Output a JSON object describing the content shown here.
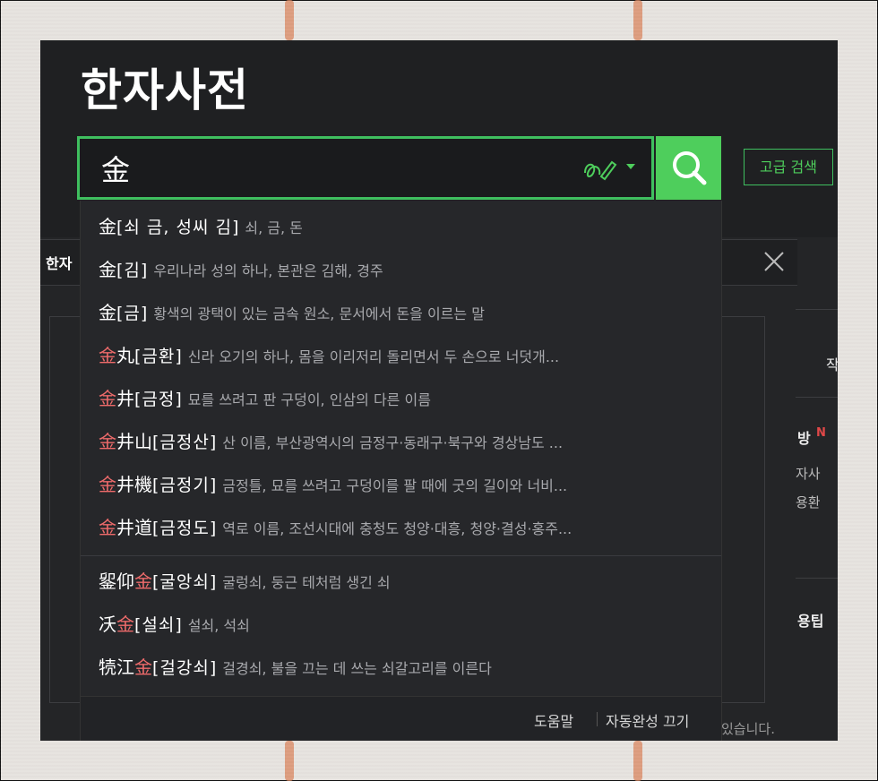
{
  "app": {
    "title": "한자사전",
    "search_value": "金",
    "advanced_search_label": "고급 검색"
  },
  "background_page": {
    "tab_label": "한자",
    "right_texts": [
      "작",
      "방",
      "N",
      "자사",
      "용환",
      "용팁",
      "있습니다."
    ]
  },
  "autocomplete": {
    "items": [
      {
        "hanja_pre": "金",
        "hanja_hl": "",
        "hanja_post": "",
        "reading": "[쇠 금, 성씨 김]",
        "definition": "쇠, 금, 돈"
      },
      {
        "hanja_pre": "金",
        "hanja_hl": "",
        "hanja_post": "",
        "reading": "[김]",
        "definition": "우리나라 성의 하나, 본관은 김해, 경주"
      },
      {
        "hanja_pre": "金",
        "hanja_hl": "",
        "hanja_post": "",
        "reading": "[금]",
        "definition": "황색의 광택이 있는 금속 원소, 문서에서 돈을 이르는 말"
      },
      {
        "hanja_pre": "",
        "hanja_hl": "金",
        "hanja_post": "丸",
        "reading": "[금환]",
        "definition": "신라 오기의 하나, 몸을 이리저리 돌리면서 두 손으로 너덧개..."
      },
      {
        "hanja_pre": "",
        "hanja_hl": "金",
        "hanja_post": "井",
        "reading": "[금정]",
        "definition": "묘를 쓰려고 판 구덩이, 인삼의 다른 이름"
      },
      {
        "hanja_pre": "",
        "hanja_hl": "金",
        "hanja_post": "井山",
        "reading": "[금정산]",
        "definition": "산 이름, 부산광역시의 금정구·동래구·북구와 경상남도 ..."
      },
      {
        "hanja_pre": "",
        "hanja_hl": "金",
        "hanja_post": "井機",
        "reading": "[금정기]",
        "definition": "금정틀, 묘를 쓰려고 구덩이를 팔 때에 굿의 길이와 너비..."
      },
      {
        "hanja_pre": "",
        "hanja_hl": "金",
        "hanja_post": "井道",
        "reading": "[금정도]",
        "definition": "역로 이름, 조선시대에 충청도 청양·대흥, 청양·결성·홍주..."
      },
      {
        "hanja_pre": "𨥫仰",
        "hanja_hl": "金",
        "hanja_post": "",
        "reading": "[굴앙쇠]",
        "definition": "굴렁쇠, 둥근 테처럼 생긴 쇠"
      },
      {
        "hanja_pre": "㓇",
        "hanja_hl": "金",
        "hanja_post": "",
        "reading": "[설쇠]",
        "definition": "설쇠, 석쇠"
      },
      {
        "hanja_pre": "㸿江",
        "hanja_hl": "金",
        "hanja_post": "",
        "reading": "[걸강쇠]",
        "definition": "걸경쇠, 불을 끄는 데 쓰는 쇠갈고리를 이른다"
      }
    ],
    "footer": {
      "help_label": "도움말",
      "autocomplete_off_label": "자동완성 끄기"
    }
  },
  "colors": {
    "accent_green": "#4ece5c",
    "highlight_red": "#ee6b6b",
    "panel_dark": "#1f2022"
  }
}
